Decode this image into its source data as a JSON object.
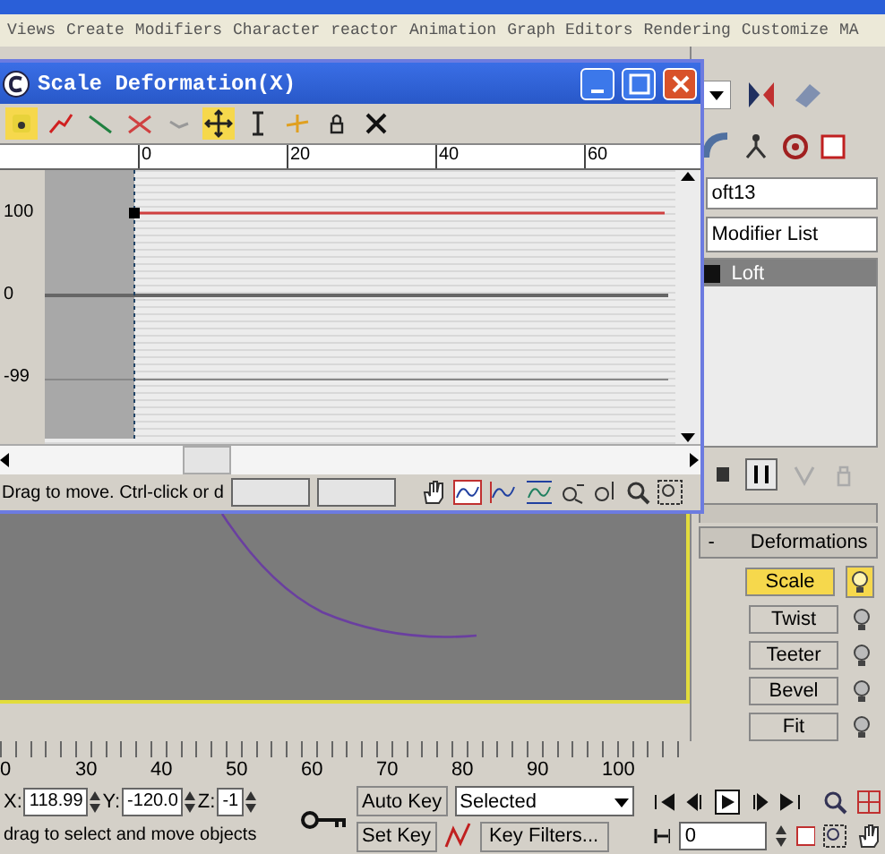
{
  "menu": [
    {
      "label": "Views"
    },
    {
      "label": "Create"
    },
    {
      "label": "Modifiers"
    },
    {
      "label": "Character"
    },
    {
      "label": "reactor"
    },
    {
      "label": "Animation"
    },
    {
      "label": "Graph Editors"
    },
    {
      "label": "Rendering"
    },
    {
      "label": "Customize"
    },
    {
      "label": "MA"
    }
  ],
  "deformation_window": {
    "title": "Scale Deformation(X)",
    "toolbar": [
      {
        "selected": true
      },
      {
        "selected": false
      },
      {
        "selected": false
      },
      {
        "selected": false
      },
      {
        "selected": false
      },
      {
        "selected": true
      },
      {
        "selected": false
      },
      {
        "selected": false
      },
      {
        "selected": false
      },
      {
        "selected": false
      }
    ],
    "x_ticks": [
      "0",
      "20",
      "40",
      "60"
    ],
    "y_labels": [
      "100",
      "0",
      "-99"
    ],
    "status": "Drag to move. Ctrl-click or d"
  },
  "command_panel": {
    "object_name": "oft13",
    "modifier_list": "Modifier List",
    "stack": [
      {
        "label": "Loft",
        "selected": true
      }
    ],
    "rollout": {
      "sign": "-",
      "title": "Deformations"
    },
    "deformations": [
      {
        "label": "Scale",
        "selected": true,
        "enabled": true
      },
      {
        "label": "Twist",
        "selected": false,
        "enabled": false
      },
      {
        "label": "Teeter",
        "selected": false,
        "enabled": false
      },
      {
        "label": "Bevel",
        "selected": false,
        "enabled": false
      },
      {
        "label": "Fit",
        "selected": false,
        "enabled": false
      }
    ]
  },
  "timeline_ticks": [
    "0",
    "30",
    "40",
    "50",
    "60",
    "70",
    "80",
    "90",
    "100"
  ],
  "coords": [
    {
      "label": "X:",
      "value": "118.99"
    },
    {
      "label": "Y:",
      "value": "-120.0"
    },
    {
      "label": "Z:",
      "value": "-1"
    }
  ],
  "auto_key": "Auto Key",
  "key_mode": "Selected",
  "set_key": "Set Key",
  "key_filters": "Key Filters...",
  "frame": "0",
  "status": "drag to select and move objects"
}
